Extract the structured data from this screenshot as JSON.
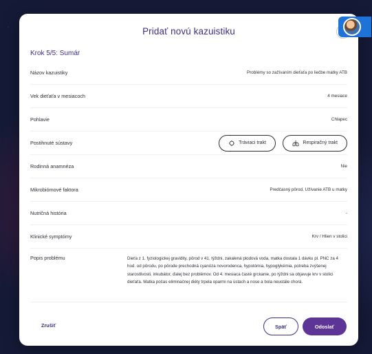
{
  "modal": {
    "title": "Pridať novú kazuistiku",
    "close_icon": "×",
    "step_label": "Krok 5/5: Sumár"
  },
  "summary": {
    "name_label": "Názov kazuistiky",
    "name_value": "Problémy so zažívaním dieťaťa po liečbe matky ATB",
    "age_label": "Vek dieťaťa v mesiacoch",
    "age_value": "4 mesiace",
    "gender_label": "Pohlavie",
    "gender_value": "Chlapec",
    "systems_label": "Postihnuté sústavy",
    "systems": [
      "Tráviaci trakt",
      "Respiračný trakt"
    ],
    "family_label": "Rodinná anamnéza",
    "family_value": "Nie",
    "microbiome_label": "Mikrobiómové faktora",
    "microbiome_value": "Predčasný pôrod, Užívanie ATB u matky",
    "nutrition_label": "Nutričná história",
    "nutrition_value": "-",
    "symptoms_label": "Klinické symptómy",
    "symptoms_value": "Krv / Hlien v stolici",
    "description_label": "Popis problému",
    "description_value": "Dieťa z 1. fyziologickej gravidity, pôrod v 41. týždni, zakalená plodová voda, matka dostala 1 dávku pl. PNC za 4 hod. od pôrodu, po pôrode prechodná cyanóza novorodenca, hypotómia, hypoglykémia, potreba zvýšenej starostlivosti, inkubátor, ďalej bez problémov. Od 4. mesiaca časté grckanie, po týždni sa objavuje krv v stolici dieťaťa. Matka počas eliminačnej diéty trpela oparmi na ústach a nose a bola neustále chorá."
  },
  "footer": {
    "cancel_label": "Zrušiť",
    "back_label": "Späť",
    "submit_label": "Odoslať"
  },
  "colors": {
    "accent": "#3d2d86",
    "primary_button": "#5c3597",
    "backdrop": "#151a37"
  }
}
